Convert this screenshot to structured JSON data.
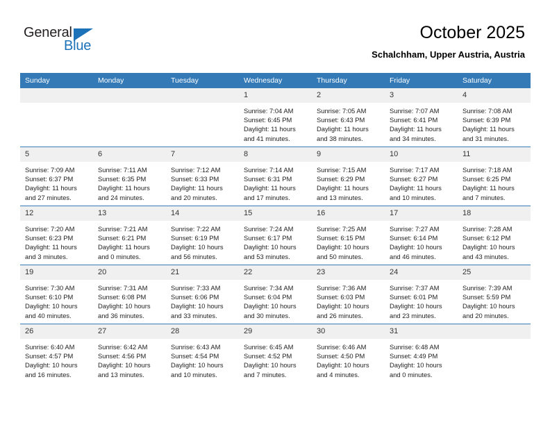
{
  "brand": {
    "name_part1": "General",
    "name_part2": "Blue",
    "accent_color": "#1c72b8"
  },
  "header": {
    "title": "October 2025",
    "subtitle": "Schalchham, Upper Austria, Austria"
  },
  "calendar": {
    "header_bg": "#337ab7",
    "daynum_bg": "#f0f0f0",
    "weekdays": [
      "Sunday",
      "Monday",
      "Tuesday",
      "Wednesday",
      "Thursday",
      "Friday",
      "Saturday"
    ],
    "weeks": [
      [
        {
          "day": "",
          "sunrise": "",
          "sunset": "",
          "daylight": ""
        },
        {
          "day": "",
          "sunrise": "",
          "sunset": "",
          "daylight": ""
        },
        {
          "day": "",
          "sunrise": "",
          "sunset": "",
          "daylight": ""
        },
        {
          "day": "1",
          "sunrise": "Sunrise: 7:04 AM",
          "sunset": "Sunset: 6:45 PM",
          "daylight": "Daylight: 11 hours and 41 minutes."
        },
        {
          "day": "2",
          "sunrise": "Sunrise: 7:05 AM",
          "sunset": "Sunset: 6:43 PM",
          "daylight": "Daylight: 11 hours and 38 minutes."
        },
        {
          "day": "3",
          "sunrise": "Sunrise: 7:07 AM",
          "sunset": "Sunset: 6:41 PM",
          "daylight": "Daylight: 11 hours and 34 minutes."
        },
        {
          "day": "4",
          "sunrise": "Sunrise: 7:08 AM",
          "sunset": "Sunset: 6:39 PM",
          "daylight": "Daylight: 11 hours and 31 minutes."
        }
      ],
      [
        {
          "day": "5",
          "sunrise": "Sunrise: 7:09 AM",
          "sunset": "Sunset: 6:37 PM",
          "daylight": "Daylight: 11 hours and 27 minutes."
        },
        {
          "day": "6",
          "sunrise": "Sunrise: 7:11 AM",
          "sunset": "Sunset: 6:35 PM",
          "daylight": "Daylight: 11 hours and 24 minutes."
        },
        {
          "day": "7",
          "sunrise": "Sunrise: 7:12 AM",
          "sunset": "Sunset: 6:33 PM",
          "daylight": "Daylight: 11 hours and 20 minutes."
        },
        {
          "day": "8",
          "sunrise": "Sunrise: 7:14 AM",
          "sunset": "Sunset: 6:31 PM",
          "daylight": "Daylight: 11 hours and 17 minutes."
        },
        {
          "day": "9",
          "sunrise": "Sunrise: 7:15 AM",
          "sunset": "Sunset: 6:29 PM",
          "daylight": "Daylight: 11 hours and 13 minutes."
        },
        {
          "day": "10",
          "sunrise": "Sunrise: 7:17 AM",
          "sunset": "Sunset: 6:27 PM",
          "daylight": "Daylight: 11 hours and 10 minutes."
        },
        {
          "day": "11",
          "sunrise": "Sunrise: 7:18 AM",
          "sunset": "Sunset: 6:25 PM",
          "daylight": "Daylight: 11 hours and 7 minutes."
        }
      ],
      [
        {
          "day": "12",
          "sunrise": "Sunrise: 7:20 AM",
          "sunset": "Sunset: 6:23 PM",
          "daylight": "Daylight: 11 hours and 3 minutes."
        },
        {
          "day": "13",
          "sunrise": "Sunrise: 7:21 AM",
          "sunset": "Sunset: 6:21 PM",
          "daylight": "Daylight: 11 hours and 0 minutes."
        },
        {
          "day": "14",
          "sunrise": "Sunrise: 7:22 AM",
          "sunset": "Sunset: 6:19 PM",
          "daylight": "Daylight: 10 hours and 56 minutes."
        },
        {
          "day": "15",
          "sunrise": "Sunrise: 7:24 AM",
          "sunset": "Sunset: 6:17 PM",
          "daylight": "Daylight: 10 hours and 53 minutes."
        },
        {
          "day": "16",
          "sunrise": "Sunrise: 7:25 AM",
          "sunset": "Sunset: 6:15 PM",
          "daylight": "Daylight: 10 hours and 50 minutes."
        },
        {
          "day": "17",
          "sunrise": "Sunrise: 7:27 AM",
          "sunset": "Sunset: 6:14 PM",
          "daylight": "Daylight: 10 hours and 46 minutes."
        },
        {
          "day": "18",
          "sunrise": "Sunrise: 7:28 AM",
          "sunset": "Sunset: 6:12 PM",
          "daylight": "Daylight: 10 hours and 43 minutes."
        }
      ],
      [
        {
          "day": "19",
          "sunrise": "Sunrise: 7:30 AM",
          "sunset": "Sunset: 6:10 PM",
          "daylight": "Daylight: 10 hours and 40 minutes."
        },
        {
          "day": "20",
          "sunrise": "Sunrise: 7:31 AM",
          "sunset": "Sunset: 6:08 PM",
          "daylight": "Daylight: 10 hours and 36 minutes."
        },
        {
          "day": "21",
          "sunrise": "Sunrise: 7:33 AM",
          "sunset": "Sunset: 6:06 PM",
          "daylight": "Daylight: 10 hours and 33 minutes."
        },
        {
          "day": "22",
          "sunrise": "Sunrise: 7:34 AM",
          "sunset": "Sunset: 6:04 PM",
          "daylight": "Daylight: 10 hours and 30 minutes."
        },
        {
          "day": "23",
          "sunrise": "Sunrise: 7:36 AM",
          "sunset": "Sunset: 6:03 PM",
          "daylight": "Daylight: 10 hours and 26 minutes."
        },
        {
          "day": "24",
          "sunrise": "Sunrise: 7:37 AM",
          "sunset": "Sunset: 6:01 PM",
          "daylight": "Daylight: 10 hours and 23 minutes."
        },
        {
          "day": "25",
          "sunrise": "Sunrise: 7:39 AM",
          "sunset": "Sunset: 5:59 PM",
          "daylight": "Daylight: 10 hours and 20 minutes."
        }
      ],
      [
        {
          "day": "26",
          "sunrise": "Sunrise: 6:40 AM",
          "sunset": "Sunset: 4:57 PM",
          "daylight": "Daylight: 10 hours and 16 minutes."
        },
        {
          "day": "27",
          "sunrise": "Sunrise: 6:42 AM",
          "sunset": "Sunset: 4:56 PM",
          "daylight": "Daylight: 10 hours and 13 minutes."
        },
        {
          "day": "28",
          "sunrise": "Sunrise: 6:43 AM",
          "sunset": "Sunset: 4:54 PM",
          "daylight": "Daylight: 10 hours and 10 minutes."
        },
        {
          "day": "29",
          "sunrise": "Sunrise: 6:45 AM",
          "sunset": "Sunset: 4:52 PM",
          "daylight": "Daylight: 10 hours and 7 minutes."
        },
        {
          "day": "30",
          "sunrise": "Sunrise: 6:46 AM",
          "sunset": "Sunset: 4:50 PM",
          "daylight": "Daylight: 10 hours and 4 minutes."
        },
        {
          "day": "31",
          "sunrise": "Sunrise: 6:48 AM",
          "sunset": "Sunset: 4:49 PM",
          "daylight": "Daylight: 10 hours and 0 minutes."
        },
        {
          "day": "",
          "sunrise": "",
          "sunset": "",
          "daylight": ""
        }
      ]
    ]
  }
}
